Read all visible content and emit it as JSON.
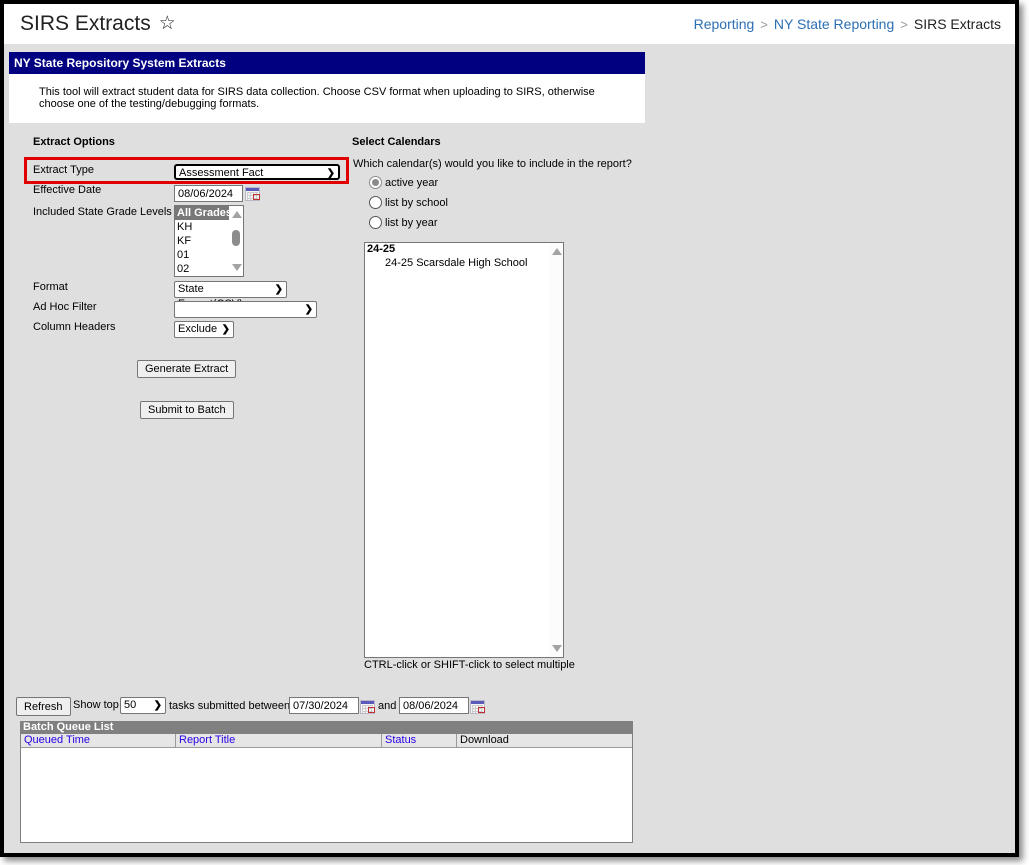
{
  "header": {
    "title": "SIRS Extracts",
    "favorite_icon": "star-outline-icon",
    "breadcrumb": [
      "Reporting",
      "NY State Reporting",
      "SIRS Extracts"
    ],
    "breadcrumb_separator": ">"
  },
  "panel": {
    "title": "NY State Repository System Extracts",
    "description": "This tool will extract student data for SIRS data collection. Choose CSV format when uploading to SIRS, otherwise choose one of the testing/debugging formats."
  },
  "extract_options": {
    "heading": "Extract Options",
    "extract_type": {
      "label": "Extract Type",
      "value": "Assessment Fact"
    },
    "effective_date": {
      "label": "Effective Date",
      "value": "08/06/2024"
    },
    "grade_levels": {
      "label": "Included State Grade Levels",
      "options": [
        "All Grades",
        "KH",
        "KF",
        "01",
        "02"
      ],
      "selected": "All Grades"
    },
    "format": {
      "label": "Format",
      "value": "State Format(CSV)"
    },
    "ad_hoc_filter": {
      "label": "Ad Hoc Filter",
      "value": ""
    },
    "column_headers": {
      "label": "Column Headers",
      "value": "Exclude"
    },
    "generate_button": "Generate Extract",
    "submit_batch_button": "Submit to Batch"
  },
  "calendars": {
    "heading": "Select Calendars",
    "question": "Which calendar(s) would you like to include in the report?",
    "radio_options": [
      {
        "label": "active year",
        "checked": true
      },
      {
        "label": "list by school",
        "checked": false
      },
      {
        "label": "list by year",
        "checked": false
      }
    ],
    "list": [
      {
        "group": "24-25",
        "items": [
          "24-25 Scarsdale High School"
        ]
      }
    ],
    "hint": "CTRL-click or SHIFT-click to select multiple"
  },
  "batch": {
    "refresh_button": "Refresh",
    "show_top_label": "Show top",
    "show_top_value": "50",
    "tasks_between_label": "tasks submitted between",
    "start_date": "07/30/2024",
    "and_label": "and",
    "end_date": "08/06/2024",
    "queue_title": "Batch Queue List",
    "columns": [
      "Queued Time",
      "Report Title",
      "Status",
      "Download"
    ],
    "rows": []
  },
  "colors": {
    "panel_header_bg": "#000080",
    "highlight": "#e10000",
    "link": "#2d6fb3",
    "column_link": "#2a00e6",
    "queue_header_bg": "#808080",
    "page_bg": "#dfdfdf"
  }
}
